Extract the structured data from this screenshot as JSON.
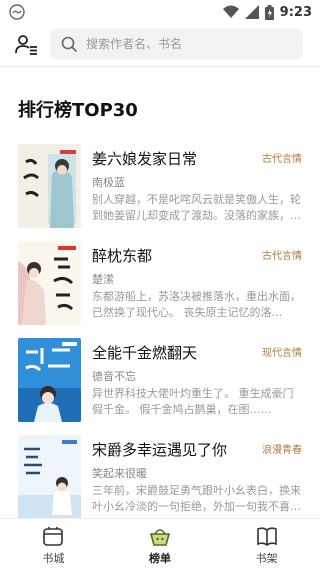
{
  "status_bar": {
    "time": "9:23",
    "signal_icon": "wifi-icon",
    "battery_icon": "battery-icon"
  },
  "header": {
    "user_icon": "user-list-icon",
    "search": {
      "placeholder": "搜索作者名、书名",
      "value": ""
    }
  },
  "section": {
    "title": "排行榜TOP30"
  },
  "books": [
    {
      "title": "姜六娘发家日常",
      "tag": "古代言情",
      "author": "南极蓝",
      "desc": "别人穿越，不是叱咤风云就是笑傲人生，轮到她姜留儿却变成了渡劫。没落的家族，不……"
    },
    {
      "title": "醉枕东都",
      "tag": "古代言情",
      "author": "楚潆",
      "desc": "东都游船上，苏洛决被推落水，重出水面，已然换了现代心。 丧失原主记忆的洛决，……"
    },
    {
      "title": "全能千金燃翻天",
      "tag": "现代言情",
      "author": "德音不忘",
      "desc": "异世界科技大佬叶灼重生了。 重生成豪门假千金。 假千金鸠占鹊巢，在图……"
    },
    {
      "title": "宋爵多幸运遇见了你",
      "tag": "浪漫青春",
      "author": "笑起来很暖",
      "desc": "三年前，宋爵鼓足勇气跟叶小幺表白，换来叶小幺冷淡的一句拒绝，外加一句我不喜欢……"
    }
  ],
  "colors": {
    "tag": "#b07a3c",
    "active_tab": "#6b8f2a"
  },
  "tabs": [
    {
      "label": "书城",
      "icon": "bookstore-icon"
    },
    {
      "label": "榜单",
      "icon": "ranking-basket-icon"
    },
    {
      "label": "书架",
      "icon": "bookshelf-icon"
    }
  ]
}
